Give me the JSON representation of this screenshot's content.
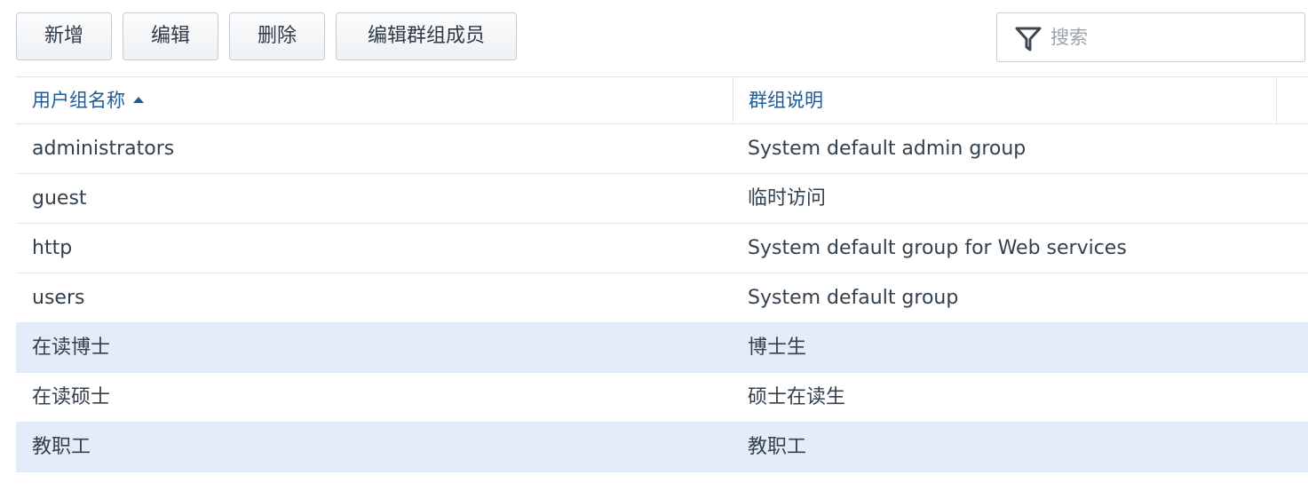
{
  "toolbar": {
    "add_label": "新增",
    "edit_label": "编辑",
    "delete_label": "删除",
    "edit_members_label": "编辑群组成员"
  },
  "search": {
    "placeholder": "搜索",
    "value": "",
    "icon": "filter-icon"
  },
  "table": {
    "columns": [
      {
        "label": "用户组名称",
        "sorted": "ascending"
      },
      {
        "label": "群组说明"
      }
    ],
    "rows": [
      {
        "name": "administrators",
        "description": "System default admin group",
        "selected": false
      },
      {
        "name": "guest",
        "description": "临时访问",
        "selected": false
      },
      {
        "name": "http",
        "description": "System default group for Web services",
        "selected": false
      },
      {
        "name": "users",
        "description": "System default group",
        "selected": false
      },
      {
        "name": "在读博士",
        "description": "博士生",
        "selected": true
      },
      {
        "name": "在读硕士",
        "description": "硕士在读生",
        "selected": false
      },
      {
        "name": "教职工",
        "description": "教职工",
        "selected": true
      }
    ]
  },
  "colors": {
    "header_text": "#1f5a99",
    "selected_row": "#e3ecf8",
    "body_text": "#33404d"
  }
}
